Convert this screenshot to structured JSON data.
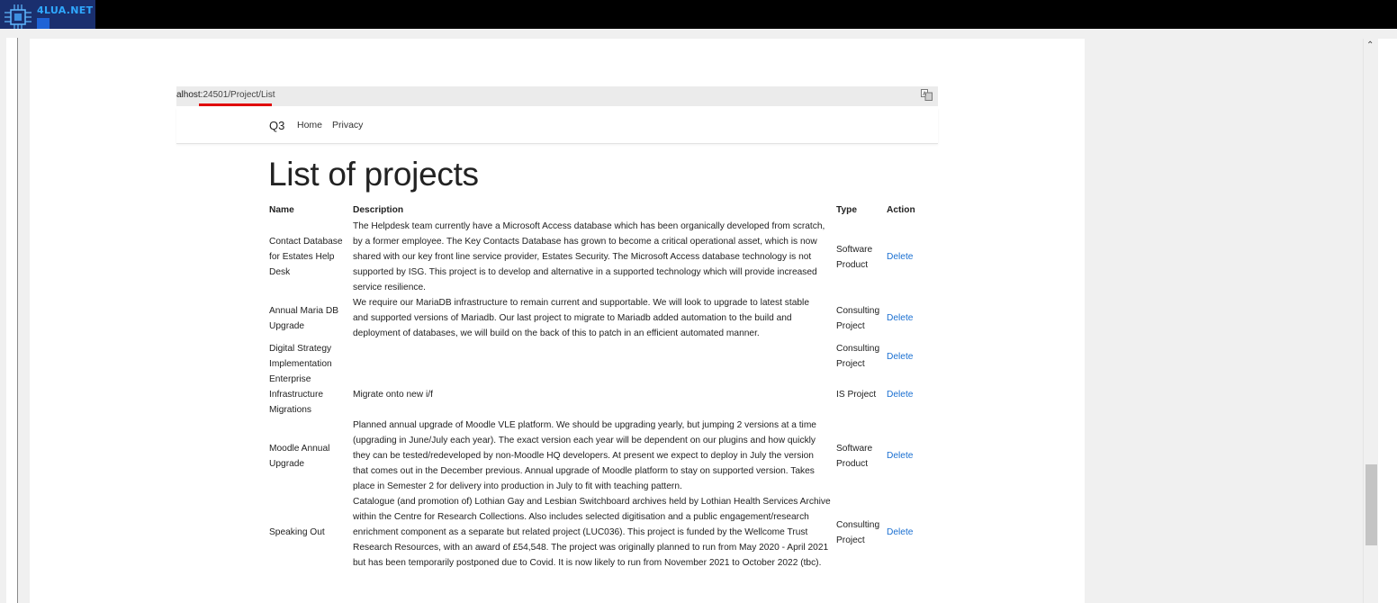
{
  "watermark": {
    "brand": "4LUA.NET"
  },
  "browser": {
    "url_prefix": "alhost:",
    "url_rest": "24501/Project/List",
    "translate_icon": "translate-icon"
  },
  "nav": {
    "brand": "Q3",
    "home": "Home",
    "privacy": "Privacy"
  },
  "page_title": "List of projects",
  "table": {
    "headers": {
      "name": "Name",
      "description": "Description",
      "type": "Type",
      "action": "Action"
    },
    "rows": [
      {
        "name": "Contact Database for Estates Help Desk",
        "description": "The Helpdesk team currently have a Microsoft Access database which has been organically developed from scratch,\nby a former employee. The Key Contacts Database has grown to become a critical operational asset, which is now\nshared with our key front line service provider, Estates Security. The Microsoft Access database technology is not\nsupported by ISG. This project is to develop and alternative in a supported technology which will provide increased\nservice resilience.",
        "type": "Software Product",
        "action": "Delete"
      },
      {
        "name": "Annual Maria DB Upgrade",
        "description": "We require our MariaDB infrastructure to remain current and supportable. We will look to upgrade to latest stable\nand supported versions of Mariadb. Our last project to migrate to Mariadb added automation to the build and\ndeployment of databases, we will build on the back of this to patch in an efficient automated manner.",
        "type": "Consulting Project",
        "action": "Delete"
      },
      {
        "name": "Digital Strategy Implementation",
        "description": "",
        "type": "Consulting Project",
        "action": "Delete"
      },
      {
        "name": "Enterprise Infrastructure Migrations",
        "description": "Migrate onto new i/f",
        "type": "IS Project",
        "action": "Delete"
      },
      {
        "name": "Moodle Annual Upgrade",
        "description": "Planned annual upgrade of Moodle VLE platform.  We should be upgrading yearly, but jumping 2 versions at a time\n(upgrading in June/July each year).  The exact version each year will be dependent on our plugins and how quickly\nthey can be tested/redeveloped by non-Moodle HQ developers. At present we expect to deploy in July the version\nthat comes out in the December previous.  Annual upgrade of Moodle platform to stay on supported version. Takes\nplace in Semester 2 for delivery into production in July to fit with teaching pattern.",
        "type": "Software Product",
        "action": "Delete"
      },
      {
        "name": "Speaking Out",
        "description": "Catalogue (and promotion of) Lothian Gay and Lesbian Switchboard archives held by Lothian Health Services Archive\nwithin the Centre for Research Collections. Also includes selected digitisation and a public engagement/research\nenrichment component as a separate but related project (LUC036). This project is funded by the Wellcome Trust\nResearch Resources, with an award of £54,548. The project was originally planned to run from May 2020 - April 2021\nbut has been temporarily postponed due to Covid. It is now likely to run from November 2021 to October 2022 (tbc).",
        "type": "Consulting Project",
        "action": "Delete"
      }
    ]
  }
}
